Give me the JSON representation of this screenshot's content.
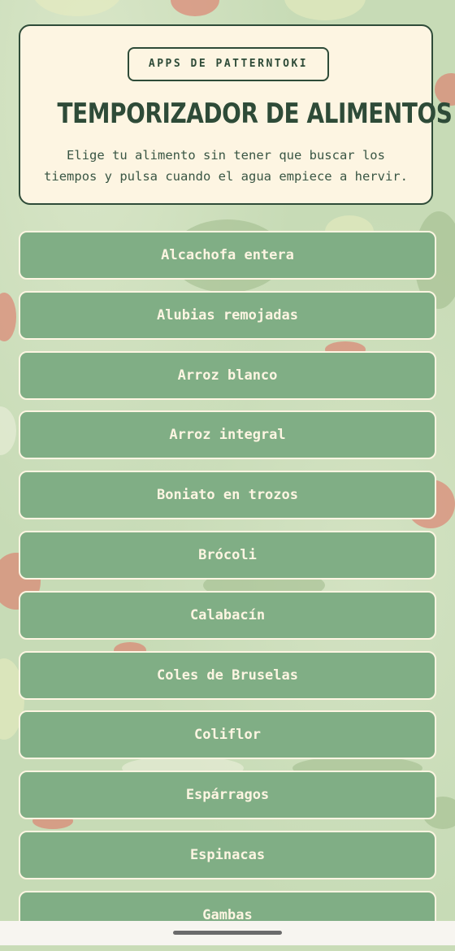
{
  "header": {
    "badge": "APPS DE PATTERNTOKI",
    "title": "TEMPORIZADOR DE ALIMENTOS",
    "subtitle": "Elige tu alimento sin tener que buscar los tiempos y pulsa cuando el agua empiece a hervir."
  },
  "foods": [
    "Alcachofa entera",
    "Alubias remojadas",
    "Arroz blanco",
    "Arroz integral",
    "Boniato en trozos",
    "Brócoli",
    "Calabacín",
    "Coles de Bruselas",
    "Coliflor",
    "Espárragos",
    "Espinacas",
    "Gambas"
  ],
  "colors": {
    "accent_dark": "#2e4b38",
    "button_green": "#80ae85",
    "cream": "#fdf5e2"
  }
}
